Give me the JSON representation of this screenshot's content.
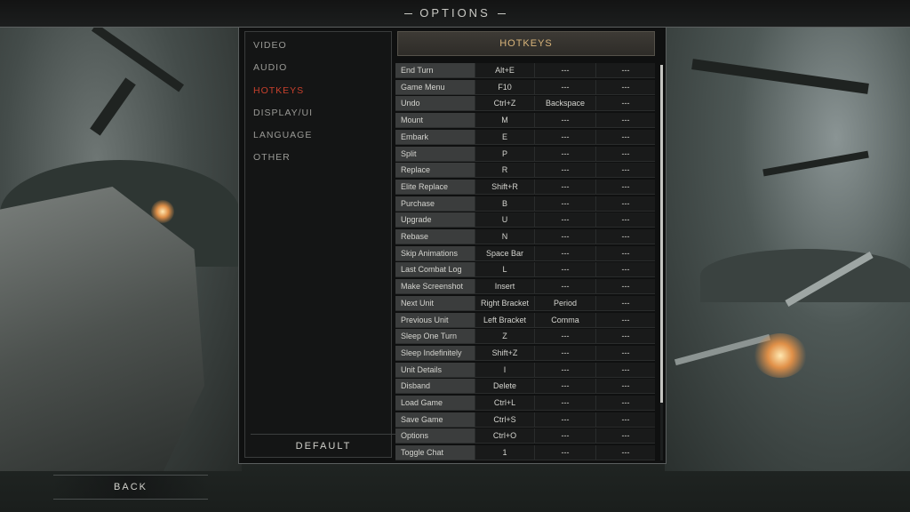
{
  "header": {
    "title": "OPTIONS"
  },
  "menu": [
    {
      "label": "VIDEO",
      "active": false
    },
    {
      "label": "AUDIO",
      "active": false
    },
    {
      "label": "HOTKEYS",
      "active": true
    },
    {
      "label": "DISPLAY/UI",
      "active": false
    },
    {
      "label": "LANGUAGE",
      "active": false
    },
    {
      "label": "OTHER",
      "active": false
    }
  ],
  "default_label": "DEFAULT",
  "panel_title": "HOTKEYS",
  "hotkeys": [
    {
      "action": "End Turn",
      "keys": [
        "Alt+E",
        "---",
        "---"
      ]
    },
    {
      "action": "Game Menu",
      "keys": [
        "F10",
        "---",
        "---"
      ]
    },
    {
      "action": "Undo",
      "keys": [
        "Ctrl+Z",
        "Backspace",
        "---"
      ]
    },
    {
      "action": "Mount",
      "keys": [
        "M",
        "---",
        "---"
      ]
    },
    {
      "action": "Embark",
      "keys": [
        "E",
        "---",
        "---"
      ]
    },
    {
      "action": "Split",
      "keys": [
        "P",
        "---",
        "---"
      ]
    },
    {
      "action": "Replace",
      "keys": [
        "R",
        "---",
        "---"
      ]
    },
    {
      "action": "Elite Replace",
      "keys": [
        "Shift+R",
        "---",
        "---"
      ]
    },
    {
      "action": "Purchase",
      "keys": [
        "B",
        "---",
        "---"
      ]
    },
    {
      "action": "Upgrade",
      "keys": [
        "U",
        "---",
        "---"
      ]
    },
    {
      "action": "Rebase",
      "keys": [
        "N",
        "---",
        "---"
      ]
    },
    {
      "action": "Skip Animations",
      "keys": [
        "Space Bar",
        "---",
        "---"
      ]
    },
    {
      "action": "Last Combat Log",
      "keys": [
        "L",
        "---",
        "---"
      ]
    },
    {
      "action": "Make Screenshot",
      "keys": [
        "Insert",
        "---",
        "---"
      ]
    },
    {
      "action": "Next Unit",
      "keys": [
        "Right Bracket",
        "Period",
        "---"
      ]
    },
    {
      "action": "Previous Unit",
      "keys": [
        "Left Bracket",
        "Comma",
        "---"
      ]
    },
    {
      "action": "Sleep One Turn",
      "keys": [
        "Z",
        "---",
        "---"
      ]
    },
    {
      "action": "Sleep Indefinitely",
      "keys": [
        "Shift+Z",
        "---",
        "---"
      ]
    },
    {
      "action": "Unit Details",
      "keys": [
        "I",
        "---",
        "---"
      ]
    },
    {
      "action": "Disband",
      "keys": [
        "Delete",
        "---",
        "---"
      ]
    },
    {
      "action": "Load Game",
      "keys": [
        "Ctrl+L",
        "---",
        "---"
      ]
    },
    {
      "action": "Save Game",
      "keys": [
        "Ctrl+S",
        "---",
        "---"
      ]
    },
    {
      "action": "Options",
      "keys": [
        "Ctrl+O",
        "---",
        "---"
      ]
    },
    {
      "action": "Toggle Chat",
      "keys": [
        "1",
        "---",
        "---"
      ]
    }
  ],
  "back_label": "BACK",
  "colors": {
    "active_menu": "#c8402c",
    "header_text": "#d8b47a"
  }
}
